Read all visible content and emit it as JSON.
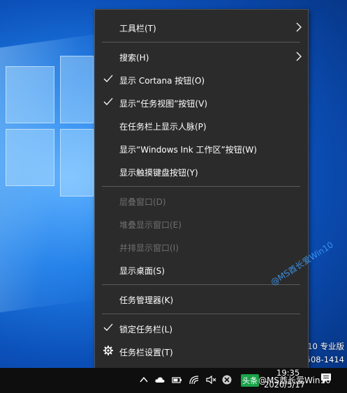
{
  "desktop": {
    "edition_text": "10 专业版",
    "build_text": "508-1414"
  },
  "context_menu": {
    "items": [
      {
        "label": "工具栏(T)",
        "checked": false,
        "disabled": false,
        "submenu": true
      },
      {
        "label": "搜索(H)",
        "checked": false,
        "disabled": false,
        "submenu": true
      },
      {
        "label": "显示 Cortana 按钮(O)",
        "checked": true,
        "disabled": false,
        "submenu": false
      },
      {
        "label": "显示“任务视图”按钮(V)",
        "checked": true,
        "disabled": false,
        "submenu": false
      },
      {
        "label": "在任务栏上显示人脉(P)",
        "checked": false,
        "disabled": false,
        "submenu": false
      },
      {
        "label": "显示“Windows Ink 工作区”按钮(W)",
        "checked": false,
        "disabled": false,
        "submenu": false
      },
      {
        "label": "显示触摸键盘按钮(Y)",
        "checked": false,
        "disabled": false,
        "submenu": false
      },
      {
        "label": "层叠窗口(D)",
        "checked": false,
        "disabled": true,
        "submenu": false
      },
      {
        "label": "堆叠显示窗口(E)",
        "checked": false,
        "disabled": true,
        "submenu": false
      },
      {
        "label": "并排显示窗口(I)",
        "checked": false,
        "disabled": true,
        "submenu": false
      },
      {
        "label": "显示桌面(S)",
        "checked": false,
        "disabled": false,
        "submenu": false
      },
      {
        "label": "任务管理器(K)",
        "checked": false,
        "disabled": false,
        "submenu": false
      },
      {
        "label": "锁定任务栏(L)",
        "checked": true,
        "disabled": false,
        "submenu": false
      },
      {
        "label": "任务栏设置(T)",
        "checked": false,
        "disabled": false,
        "submenu": false,
        "icon": "gear-icon"
      }
    ],
    "watermark": "@MS酋长爱Win10"
  },
  "taskbar": {
    "clock_time": "19:35",
    "clock_date": "2020/5/17",
    "tray_icons": [
      "chevron-up-icon",
      "onedrive-cloud-icon",
      "battery-icon",
      "wifi-icon",
      "volume-muted-icon",
      "close-circle-icon"
    ],
    "toutiao_badge": "头条",
    "author_overlay": "@MS酋长爱Win10",
    "notification_icon": "action-center-icon"
  },
  "colors": {
    "menu_bg": "#2b2b2b",
    "menu_text": "#ffffff",
    "menu_disabled_text": "#6f6f6f",
    "separator": "#5a5a5a",
    "taskbar_bg": "#0e0e0e",
    "watermark_blue": "#3ea0ff"
  }
}
